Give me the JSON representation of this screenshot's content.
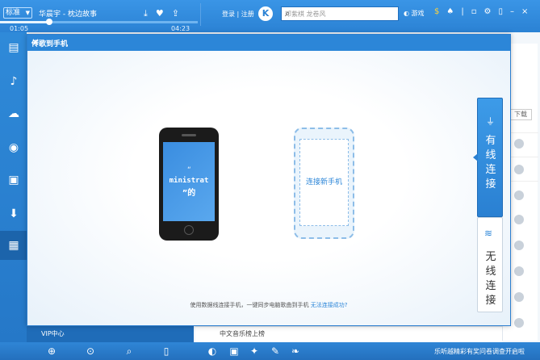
{
  "player": {
    "quality": "标准",
    "song": "华晨宇 - 枕边故事",
    "current_time": "01:05",
    "total_time": "04:23",
    "progress": 0.25
  },
  "header": {
    "login": "登录 | 注册",
    "logo_letter": "K",
    "search_placeholder": "邓紫棋 龙卷风",
    "game_label": "游戏"
  },
  "sidebar": {
    "items": [
      "list-icon",
      "music-note-icon",
      "cloud-icon",
      "radio-icon",
      "video-icon",
      "download-icon",
      "grid-icon"
    ],
    "vip_label": "VIP中心"
  },
  "background": {
    "tag": "下载",
    "list_row": "中文音乐榜上榜"
  },
  "dialog": {
    "title": "传歌到手机",
    "close": "×",
    "phone_text_1": "ministrat",
    "phone_text_2": "”的",
    "phone_quote": "“",
    "new_phone_label": "连接新手机",
    "hint_prefix": "使用数据线连接手机，一键同步电脑歌曲到手机 ",
    "hint_link": "无法连接成功?",
    "tab_wired": "有线连接",
    "tab_wireless": "无线连接"
  },
  "footer": {
    "notice": "乐听越精彩有奖问卷调查开启啦"
  },
  "colors": {
    "brand": "#2b82d4",
    "accent": "#2c86d8"
  }
}
